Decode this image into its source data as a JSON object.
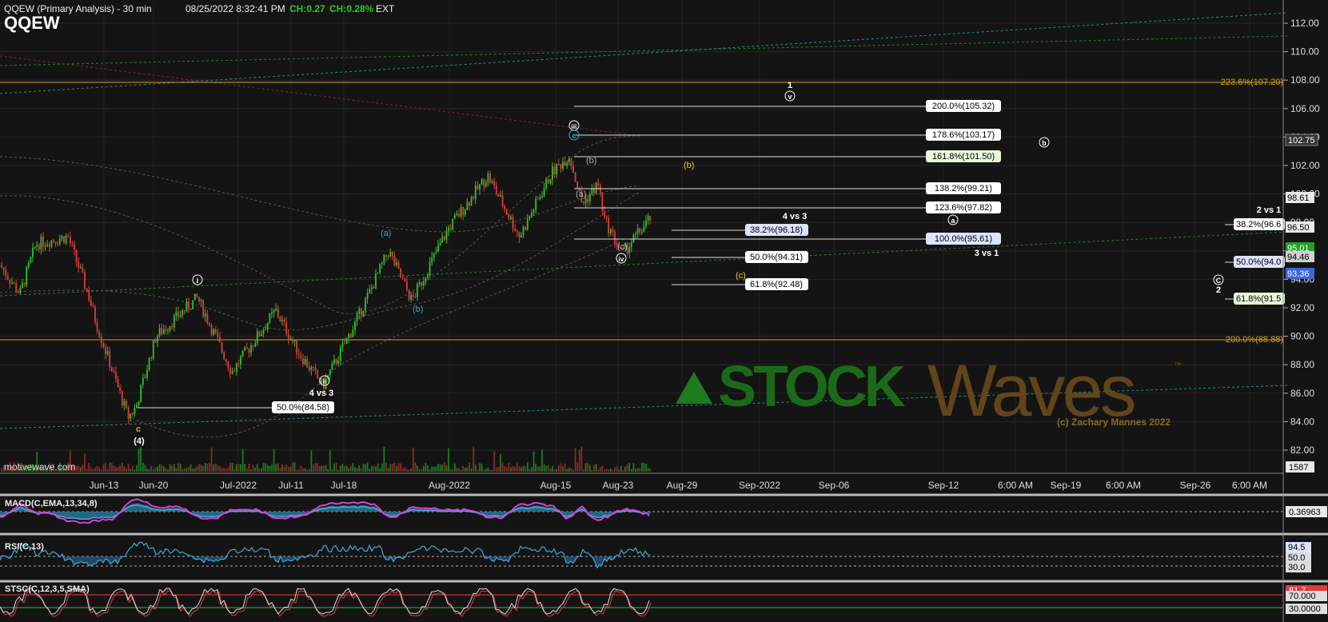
{
  "header": {
    "title": "QQEW (Primary Analysis) - 30 min",
    "datetime": "08/25/2022 8:32:41 PM",
    "ch_points": "CH:0.27",
    "ch_pct": "CH:0.28%",
    "session": "EXT"
  },
  "symbol": "QQEW",
  "credit": "motivewave.com",
  "watermark": {
    "brand": "STOCK",
    "brand2": "Waves",
    "tm": "™",
    "copyright": "(c) Zachary Mannes 2022"
  },
  "colors": {
    "bg": "#141414",
    "up": "#2ec42e",
    "down": "#e03c3c",
    "orange": "#e8a41c",
    "cyan": "#2aa8b8",
    "macd": "#d642d6",
    "rsi": "#3aaad8"
  },
  "price_axis": {
    "ticks": [
      "112.00",
      "110.00",
      "108.00",
      "106.00",
      "104.00",
      "102.00",
      "100.00",
      "98.00",
      "96.00",
      "94.00",
      "92.00",
      "90.00",
      "88.00",
      "86.00",
      "84.00",
      "82.00"
    ],
    "last_price": "102.75",
    "tags": [
      "98.61",
      "96.50",
      "95.01",
      "94.46",
      "93.36"
    ],
    "volume_label": "1587"
  },
  "time_axis": [
    "Jun-13",
    "Jun-20",
    "Jul-2022",
    "Jul-11",
    "Jul-18",
    "Aug-2022",
    "Aug-15",
    "Aug-23",
    "Aug-29",
    "Sep-2022",
    "Sep-06",
    "Sep-12",
    "6:00 AM",
    "Sep-19",
    "6:00 AM",
    "Sep-26",
    "6:00 AM"
  ],
  "fib_targets": [
    {
      "label": "200.0%(105.32)",
      "price": 105.32
    },
    {
      "label": "178.6%(103.17)",
      "price": 103.17
    },
    {
      "label": "161.8%(101.50)",
      "price": 101.5
    },
    {
      "label": "138.2%(99.21)",
      "price": 99.21
    },
    {
      "label": "123.6%(97.82)",
      "price": 97.82
    },
    {
      "label": "100.0%(95.61)",
      "price": 95.61
    }
  ],
  "fib_retrace": [
    {
      "label": "38.2%(96.18)",
      "price": 96.18
    },
    {
      "label": "50.0%(94.31)",
      "price": 94.31
    },
    {
      "label": "61.8%(92.48)",
      "price": 92.48
    }
  ],
  "fib_right": [
    {
      "label": "38.2%(96.6",
      "price": 96.6
    },
    {
      "label": "50.0%(94.0",
      "price": 94.0
    },
    {
      "label": "61.8%(91.5",
      "price": 91.5
    }
  ],
  "fib_low_label": "50.0%(84.58)",
  "orange_levels": [
    {
      "label": "223.6%(107.20)",
      "price": 107.2
    },
    {
      "label": "200.0%(88.88)",
      "price": 88.88
    }
  ],
  "wave_labels": {
    "one": "1",
    "two": "2",
    "four": "(4)",
    "c_major": "c",
    "roman_i": "i",
    "roman_ii": "ii",
    "roman_iii": "iii",
    "roman_iv": "iv",
    "roman_v": "v",
    "a": "(a)",
    "b": "(b)",
    "c": "(c)",
    "c_circle": "c",
    "a_circle": "a",
    "b_circle": "b",
    "big_c": "C"
  },
  "notes": {
    "vs43a": "4 vs 3",
    "vs43b": "4 vs 3",
    "vs31": "3 vs 1",
    "vs21": "2 vs 1"
  },
  "indicators": {
    "macd": {
      "title": "MACD(C,EMA,13,34,8)",
      "value": "0.36963"
    },
    "rsi": {
      "title": "RSI(C,13)",
      "value": "94.5",
      "levels": [
        "50.0",
        "30.0"
      ]
    },
    "stoch": {
      "title": "STSC(C,12,3,5,SMA)",
      "value": "81.7",
      "levels": [
        "70.000",
        "30.0000"
      ]
    }
  }
}
